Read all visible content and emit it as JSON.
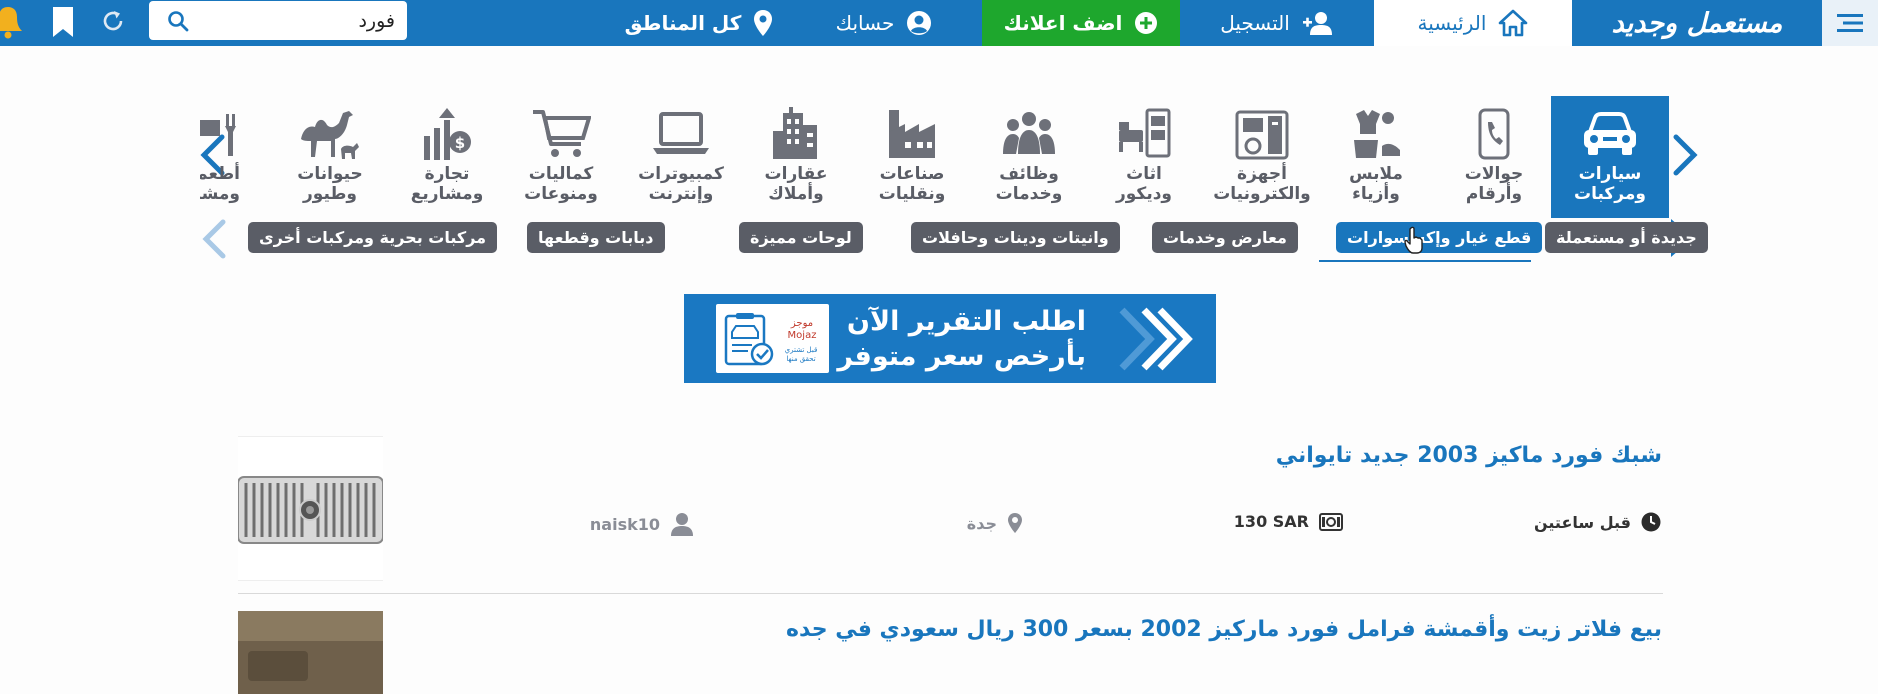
{
  "topbar": {
    "logo_text": "مستعمل وجديد",
    "home_label": "الرئيسية",
    "register_label": "التسجيل",
    "add_ad_label": "اضف اعلانك",
    "account_label": "حسابك",
    "regions_label": "كل المناطق",
    "search_value": "فورد"
  },
  "categories": [
    {
      "label": "سيارات\nومركبات",
      "icon": "car-icon",
      "active": true
    },
    {
      "label": "جوالات\nوأرقام",
      "icon": "phone-icon"
    },
    {
      "label": "ملابس\nوأزياء",
      "icon": "clothes-icon"
    },
    {
      "label": "أجهزة\nوالكترونيات",
      "icon": "appliances-icon"
    },
    {
      "label": "اثاث\nوديكور",
      "icon": "furniture-icon"
    },
    {
      "label": "وظائف\nوخدمات",
      "icon": "people-icon"
    },
    {
      "label": "صناعات\nونقليات",
      "icon": "factory-icon"
    },
    {
      "label": "عقارات\nوأملاك",
      "icon": "building-icon"
    },
    {
      "label": "كمبيوترات\nوإنترنت",
      "icon": "laptop-icon"
    },
    {
      "label": "كماليات\nومنوعات",
      "icon": "cart-icon"
    },
    {
      "label": "تجارة\nومشاريع",
      "icon": "money-growth-icon"
    },
    {
      "label": "حيوانات\nوطيور",
      "icon": "camel-icon"
    },
    {
      "label": "أطعمة\nومشروبات",
      "icon": "food-icon"
    }
  ],
  "subcategories": [
    "جديدة أو مستعملة",
    "قطع غيار وإكسسوارات",
    "معارض وخدمات",
    "وانيتات ودينات وحافلات",
    "لوحات مميزة",
    "دبابات وقطعها",
    "مركبات بحرية ومركبات أخرى"
  ],
  "banner": {
    "line1": "اطلب التقرير الآن",
    "line2": "بأرخص سعر متوفر",
    "brand": "موجز\nMojaz",
    "tagline": "قبل تشتري\nتحقق منها"
  },
  "listings": [
    {
      "title": "شبك فورد ماكيز 2003 جديد تايواني",
      "time": "قبل ساعتين",
      "price": "130 SAR",
      "city": "جدة",
      "user": "naisk10"
    },
    {
      "title": "بيع فلاتر زيت وأقمشة فرامل فورد ماركيز 2002 بسعر 300 ريال سعودي في جده"
    }
  ],
  "colors": {
    "brand_blue": "#1976bd",
    "add_green": "#1ea72d",
    "gray": "#5a5d66"
  }
}
